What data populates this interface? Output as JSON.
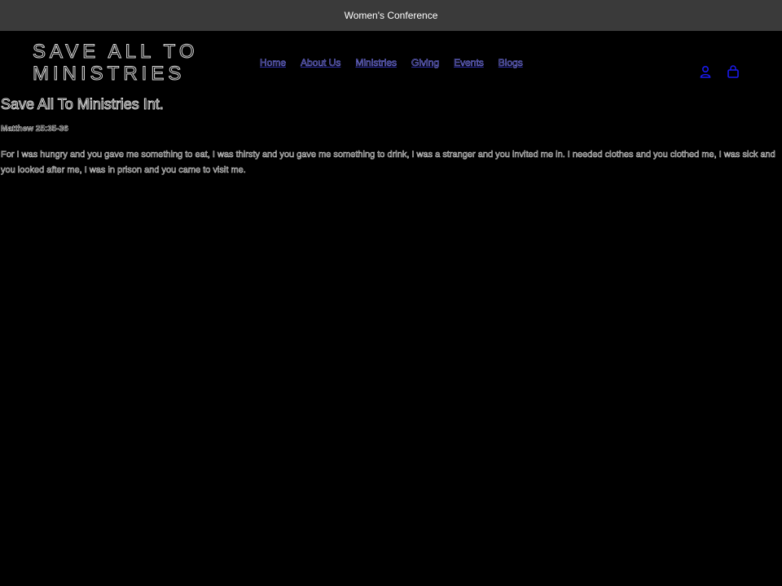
{
  "announcement": {
    "text": "Women's Conference"
  },
  "header": {
    "logo_line1": "SAVE ALL TO",
    "logo_line2": "MINISTRIES",
    "nav": [
      {
        "label": "Home"
      },
      {
        "label": "About Us"
      },
      {
        "label": "Ministries"
      },
      {
        "label": "Giving"
      },
      {
        "label": "Events"
      },
      {
        "label": "Blogs"
      }
    ],
    "account_icon": "account-icon",
    "cart_icon": "cart-icon"
  },
  "main": {
    "title": "Save All To Ministries Int.",
    "verse_reference": "Matthew 25:35-36",
    "verse_text": "For I was hungry and you gave me something to eat, I was thirsty and you gave me something to drink, I was a stranger and you invited me in. I needed clothes and you clothed me, I was sick and you looked after me, I was in prison and you came to visit me."
  },
  "colors": {
    "background": "#000000",
    "announcement_bar": "#3a3a3a",
    "link": "#7777ee",
    "icon": "#1a1aee"
  }
}
